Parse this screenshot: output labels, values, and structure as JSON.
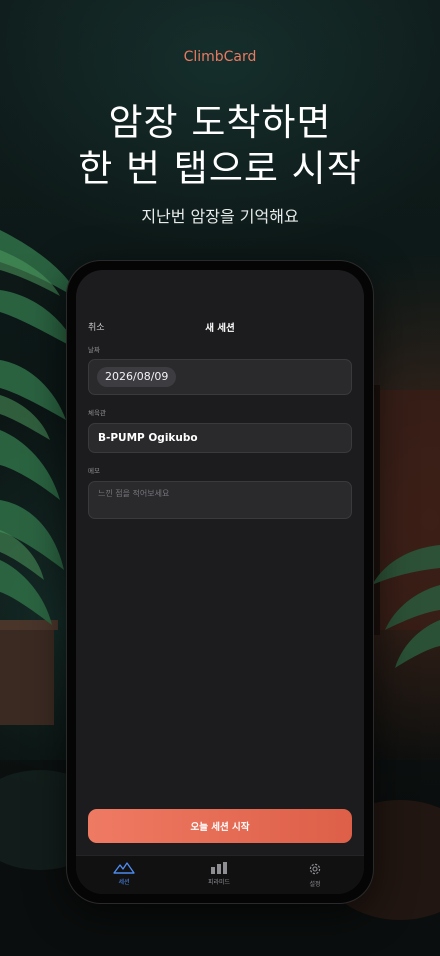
{
  "promo": {
    "brand": "ClimbCard",
    "headline_line1": "암장 도착하면",
    "headline_line2": "한 번 탭으로 시작",
    "subheadline": "지난번 암장을 기억해요"
  },
  "nav": {
    "cancel_label": "취소",
    "title": "새 세션"
  },
  "form": {
    "date_label": "날짜",
    "date_value": "2026/08/09",
    "gym_label": "체육관",
    "gym_value": "B-PUMP Ogikubo",
    "memo_label": "메모",
    "memo_placeholder": "느낀 점을 적어보세요"
  },
  "primary_action": {
    "label": "오늘 세션 시작"
  },
  "tabbar": {
    "tabs": [
      {
        "label": "세션",
        "icon": "mountain-icon",
        "active": true
      },
      {
        "label": "피라미드",
        "icon": "bar-chart-icon",
        "active": false
      },
      {
        "label": "설정",
        "icon": "gear-icon",
        "active": false
      }
    ]
  },
  "colors": {
    "accent": "#e87a62",
    "button_start": "#ef7a63",
    "button_end": "#dd5f48",
    "tab_active": "#4f8ef7",
    "screen_bg": "#1c1c1e",
    "field_bg": "#2a2a2d"
  }
}
